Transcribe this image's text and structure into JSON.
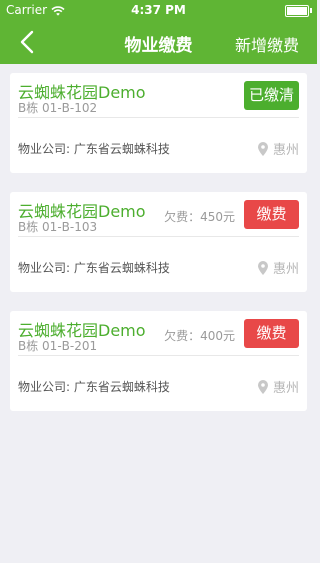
{
  "status_bar": {
    "carrier": "Carrier",
    "time": "4:37 PM"
  },
  "nav": {
    "title": "物业缴费",
    "action": "新增缴费"
  },
  "cards": [
    {
      "name": "云蜘蛛花园Demo",
      "unit": "B栋 01-B-102",
      "owed": "",
      "button": "已缴清",
      "company": "物业公司: 广东省云蜘蛛科技",
      "city": "惠州"
    },
    {
      "name": "云蜘蛛花园Demo",
      "unit": "B栋 01-B-103",
      "owed": "欠费：450元",
      "button": "缴费",
      "company": "物业公司: 广东省云蜘蛛科技",
      "city": "惠州"
    },
    {
      "name": "云蜘蛛花园Demo",
      "unit": "B栋 01-B-201",
      "owed": "欠费：400元",
      "button": "缴费",
      "company": "物业公司: 广东省云蜘蛛科技",
      "city": "惠州"
    }
  ],
  "colors": {
    "brand_green": "#5fb534",
    "pay_red": "#e84848"
  }
}
